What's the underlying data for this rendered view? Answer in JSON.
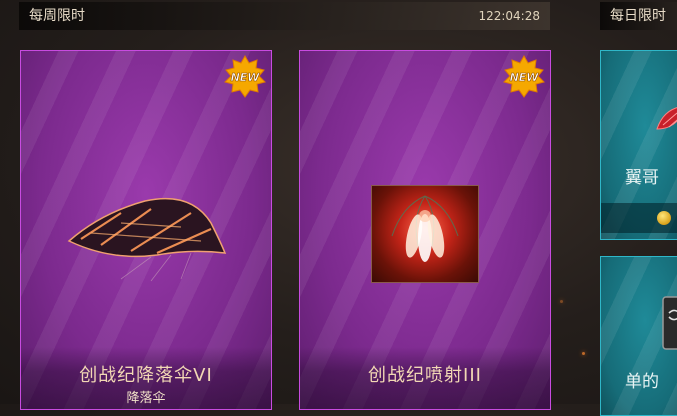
{
  "weekly": {
    "title": "每周限时",
    "timer": "122:04:28",
    "items": [
      {
        "name": "创战纪降落伞VI",
        "category": "降落伞",
        "badge": "NEW"
      },
      {
        "name": "创战纪喷射III",
        "category": "",
        "badge": "NEW"
      }
    ]
  },
  "daily": {
    "title": "每日限时",
    "items": [
      {
        "name": "翼哥"
      },
      {
        "name": "单的"
      }
    ]
  },
  "colors": {
    "weekly_card_border": "#c84be0",
    "weekly_card_bg": "#7c2a8e",
    "daily_card_border": "#2fb7c9",
    "daily_card_bg": "#166c78",
    "new_badge": "#f5a800",
    "item_name_text": "#f2d8b4"
  },
  "icons": {
    "parachute": "parachute-icon",
    "jet_trail": "jet-trail-icon",
    "wings": "wings-icon",
    "coin": "coin-icon",
    "box": "loot-box-icon"
  }
}
